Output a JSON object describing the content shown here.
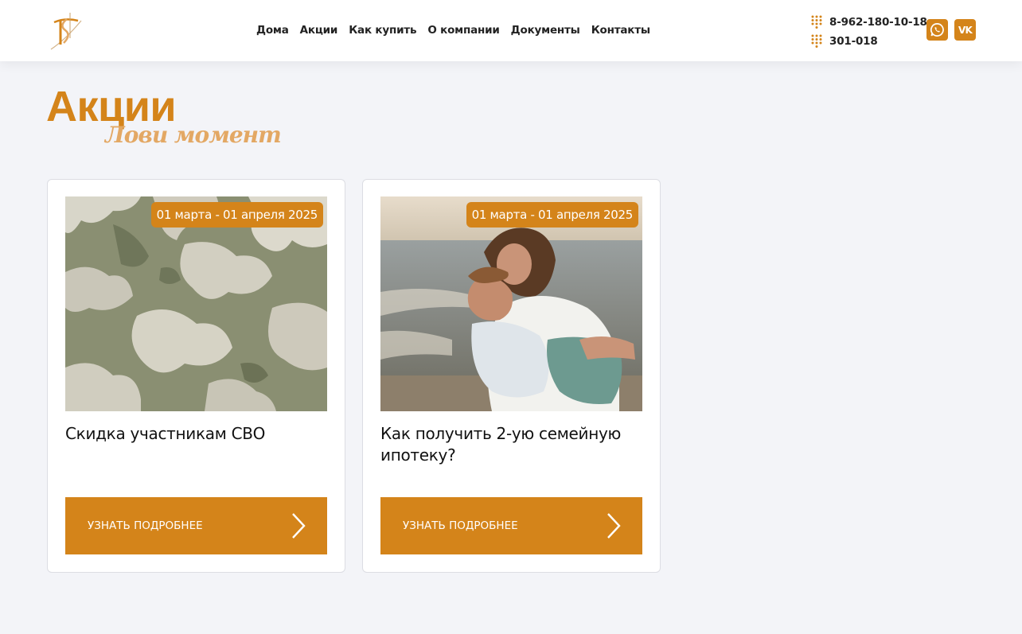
{
  "nav": {
    "items": [
      "Дома",
      "Акции",
      "Как купить",
      "О компании",
      "Документы",
      "Контакты"
    ]
  },
  "contacts": {
    "phones": [
      "8-962-180-10-18",
      "301-018"
    ]
  },
  "social": {
    "whatsapp_icon": "whatsapp-icon",
    "vk_label": "VK"
  },
  "page": {
    "title": "Акции",
    "subtitle": "Лови момент"
  },
  "cards": [
    {
      "date": "01 марта - 01 апреля 2025",
      "title": "Скидка участникам СВО",
      "button": "УЗНАТЬ ПОДРОБНЕЕ",
      "image": "sycamore-bark-photo"
    },
    {
      "date": "01 марта - 01 апреля 2025",
      "title": "Как получить 2-ую семейную ипотеку?",
      "button": "УЗНАТЬ ПОДРОБНЕЕ",
      "image": "mother-and-child-beach-photo"
    }
  ],
  "colors": {
    "accent": "#d4841a",
    "accent_light": "#e3a864",
    "background": "#f3f4f8"
  }
}
